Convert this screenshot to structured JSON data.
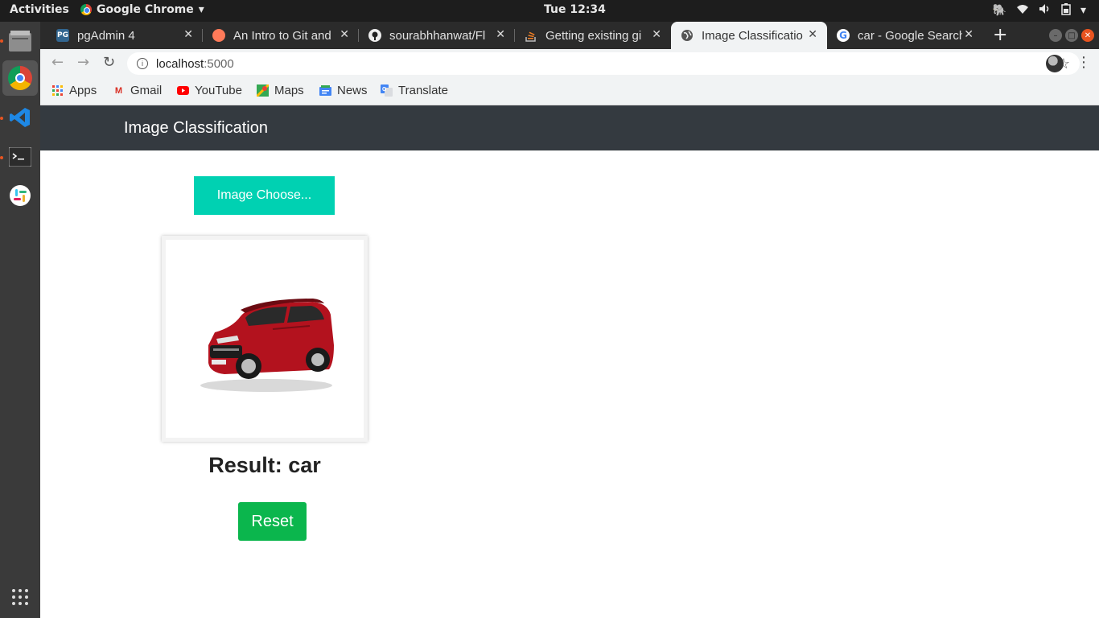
{
  "system": {
    "activities": "Activities",
    "app_name": "Google Chrome",
    "clock": "Tue 12:34"
  },
  "tabs": [
    {
      "title": "pgAdmin 4",
      "icon": "pgadmin-icon"
    },
    {
      "title": "An Intro to Git and",
      "icon": "hubspot-icon"
    },
    {
      "title": "sourabhhanwat/Fl",
      "icon": "github-icon"
    },
    {
      "title": "Getting existing gi",
      "icon": "stackoverflow-icon"
    },
    {
      "title": "Image Classificatio",
      "icon": "globe-icon",
      "active": true
    },
    {
      "title": "car - Google Search",
      "icon": "google-icon"
    }
  ],
  "address": {
    "host": "localhost",
    "port": ":5000"
  },
  "bookmarks": [
    "Apps",
    "Gmail",
    "YouTube",
    "Maps",
    "News",
    "Translate"
  ],
  "page": {
    "brand": "Image Classification",
    "choose_label": "Image Choose...",
    "result_text": "Result: car",
    "reset_label": "Reset"
  },
  "colors": {
    "navbar": "#343a40",
    "choose_button": "#00d1b2",
    "reset_button": "#0bb64d",
    "car_body": "#b3121e"
  }
}
